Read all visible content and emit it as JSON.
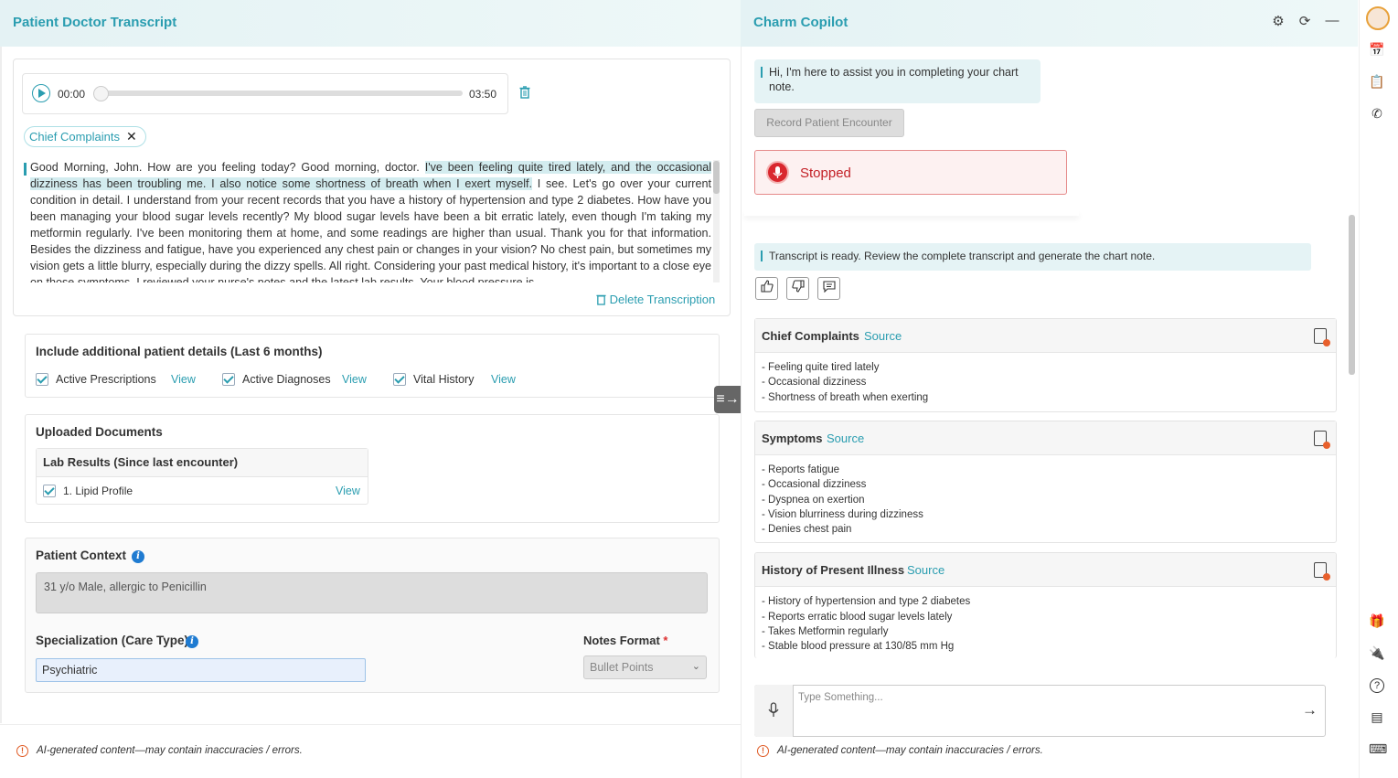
{
  "left_panel": {
    "title": "Patient Doctor Transcript",
    "audio": {
      "current": "00:00",
      "duration": "03:50"
    },
    "chip_label": "Chief Complaints",
    "chip_close": "✕",
    "transcript": {
      "part1": "Good Morning, John. How are you feeling today? Good morning, doctor. ",
      "highlight": "I've been feeling quite tired lately, and the occasional dizziness has been troubling me. I also notice some shortness of breath when I exert myself.",
      "part2": " I see. Let's go over your current condition in detail. I understand from your recent records that you have a history of hypertension and type 2 diabetes. How have you been managing your blood sugar levels recently? My blood sugar levels have been a bit erratic lately, even though I'm taking my metformin regularly. I've been monitoring them at home, and some readings are higher than usual. Thank you for that information. Besides the dizziness and fatigue, have you experienced any chest pain or changes in your vision? No chest pain, but sometimes my vision gets a little blurry, especially during the dizzy spells. All right. Considering your past medical history, it's important to a close eye on those symptoms. I reviewed your nurse's notes and the latest lab results. Your blood pressure is"
    },
    "delete_label": "Delete Transcription",
    "additional": {
      "title": "Include additional patient details (Last 6 months)",
      "items": [
        {
          "label": "Active Prescriptions",
          "link": "View"
        },
        {
          "label": "Active Diagnoses",
          "link": "View"
        },
        {
          "label": "Vital History",
          "link": "View"
        }
      ]
    },
    "uploaded": {
      "title": "Uploaded Documents",
      "group": "Lab Results (Since last encounter)",
      "item": "1. Lipid Profile",
      "link": "View"
    },
    "context": {
      "label": "Patient Context",
      "value": "31 y/o Male, allergic to Penicillin"
    },
    "specialization": {
      "label": "Specialization (Care Type)",
      "value": "Psychiatric"
    },
    "notes_format": {
      "label": "Notes Format",
      "required": "*",
      "value": "Bullet Points"
    },
    "footer": "AI-generated content—may contain inaccuracies / errors.",
    "warn_glyph": "!",
    "info_glyph": "i"
  },
  "right_panel": {
    "title": "Charm Copilot",
    "greeting": "Hi, I'm here to assist you in completing your chart note.",
    "record_label": "Record Patient Encounter",
    "status": "Stopped",
    "ready_msg": "Transcript is ready. Review the complete transcript and generate the chart note.",
    "sections": [
      {
        "title": "Chief Complaints",
        "source": "Source",
        "items": [
          "- Feeling quite tired lately",
          "- Occasional dizziness",
          "- Shortness of breath when exerting"
        ]
      },
      {
        "title": "Symptoms",
        "source": "Source",
        "items": [
          "- Reports fatigue",
          "- Occasional dizziness",
          "- Dyspnea on exertion",
          "- Vision blurriness during dizziness",
          "- Denies chest pain"
        ]
      },
      {
        "title": "History of Present Illness",
        "source": "Source",
        "items": [
          "- History of hypertension and type 2 diabetes",
          "- Reports erratic blood sugar levels lately",
          "- Takes Metformin regularly",
          "- Stable blood pressure at 130/85 mm Hg"
        ]
      }
    ],
    "input_placeholder": "Type Something...",
    "footer": "AI-generated content—may contain inaccuracies / errors."
  },
  "icons": {
    "gear": "⚙",
    "refresh": "⟳",
    "minimize": "—",
    "thumbs_up": "👍",
    "thumbs_down": "👎",
    "comment": "💬",
    "send": "→",
    "mic": "🎙",
    "collapse": "≡→",
    "gift": "🎁",
    "plug": "🔌",
    "help": "?",
    "layout": "▤",
    "keyboard": "⌨",
    "phone": "✆",
    "clipboard": "📋",
    "calendar": "📅"
  }
}
